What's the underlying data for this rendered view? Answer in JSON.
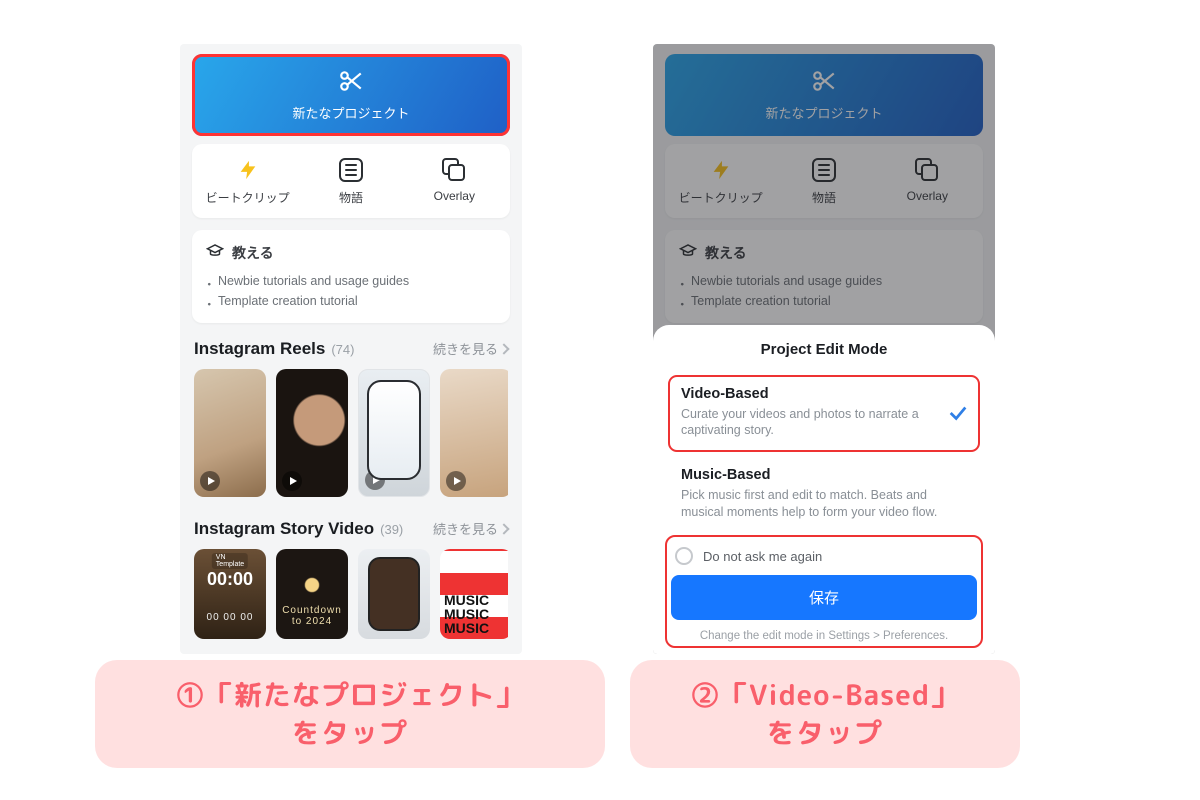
{
  "left": {
    "new_project_label": "新たなプロジェクト",
    "quick": {
      "beat": "ビートクリップ",
      "story": "物語",
      "overlay": "Overlay"
    },
    "teach": {
      "title": "教える",
      "items": [
        "Newbie tutorials and usage guides",
        "Template creation tutorial"
      ]
    },
    "sections": [
      {
        "title": "Instagram Reels",
        "count": "(74)",
        "more": "続きを見る"
      },
      {
        "title": "Instagram Story Video",
        "count": "(39)",
        "more": "続きを見る"
      }
    ],
    "story_thumbs": {
      "vn_tag": "VN Template",
      "t1_time": "00:00",
      "t2_sub": "Countdown to 2024",
      "t4_text": "MUSIC MUSIC MUSIC",
      "subsegs": "00  00  00"
    }
  },
  "right": {
    "new_project_label": "新たなプロジェクト",
    "quick": {
      "beat": "ビートクリップ",
      "story": "物語",
      "overlay": "Overlay"
    },
    "teach": {
      "title": "教える",
      "items": [
        "Newbie tutorials and usage guides",
        "Template creation tutorial"
      ]
    },
    "sheet": {
      "title": "Project Edit Mode",
      "video": {
        "title": "Video-Based",
        "desc": "Curate your videos and photos to narrate a captivating story."
      },
      "music": {
        "title": "Music-Based",
        "desc": "Pick music first and edit to match. Beats and musical moments help to form your video flow."
      },
      "dont_ask": "Do not ask me again",
      "save": "保存",
      "hint": "Change the edit mode in Settings > Preferences."
    }
  },
  "annotations": {
    "left": "①「新たなプロジェクト」\nをタップ",
    "right": "②「Video-Based」\nをタップ"
  }
}
